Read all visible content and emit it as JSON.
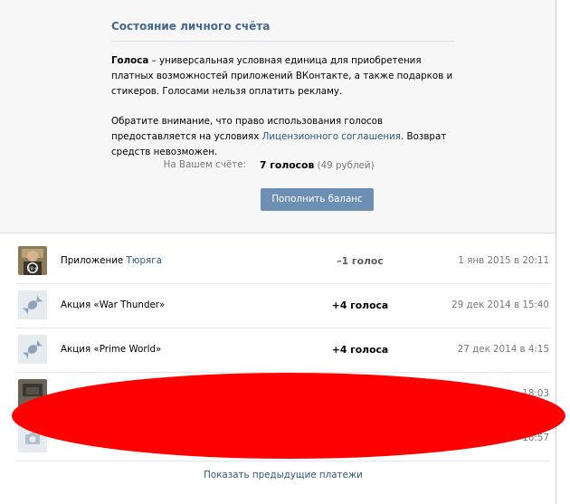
{
  "section": {
    "title": "Состояние личного счёта"
  },
  "info": {
    "term": "Голоса",
    "definition": " – универсальная условная единица для приобретения платных возможностей приложений ВКонтакте, а также подарков и стикеров. Голосами нельзя оплатить рекламу.",
    "notice_before": "Обратите внимание, что право использования голосов предоставляется на условиях ",
    "notice_link": "Лицензионного соглашения",
    "notice_after": ". Возврат средств невозможен."
  },
  "balance": {
    "label": "На Вашем счёте:",
    "votes": "7 голосов",
    "rubles": "(49 рублей)"
  },
  "topup_button": "Пополнить баланс",
  "transactions": [
    {
      "desc_prefix": "Приложение ",
      "desc_link": "Тюряга",
      "amount": "–1 голос",
      "date": "1 янв 2015 в 20:11",
      "icon": "app-avatar-icon"
    },
    {
      "desc_prefix": "Акция «War Thunder»",
      "desc_link": "",
      "amount": "+4 голоса",
      "date": "29 дек 2014 в 15:40",
      "icon": "candy-icon"
    },
    {
      "desc_prefix": "Акция «Prime World»",
      "desc_link": "",
      "amount": "+4 голоса",
      "date": "27 дек 2014 в 4:15",
      "icon": "candy-icon"
    },
    {
      "desc_prefix": "",
      "desc_link": "",
      "amount": "",
      "date": "18:03",
      "icon": "app-avatar-icon"
    },
    {
      "desc_prefix": "",
      "desc_link": "",
      "amount": "",
      "date": "16:57",
      "icon": "camera-icon"
    }
  ],
  "more_link": "Показать предыдущие платежи",
  "colors": {
    "accent": "#45688e",
    "button": "#6d8fb3",
    "redaction": "#ff0000"
  }
}
